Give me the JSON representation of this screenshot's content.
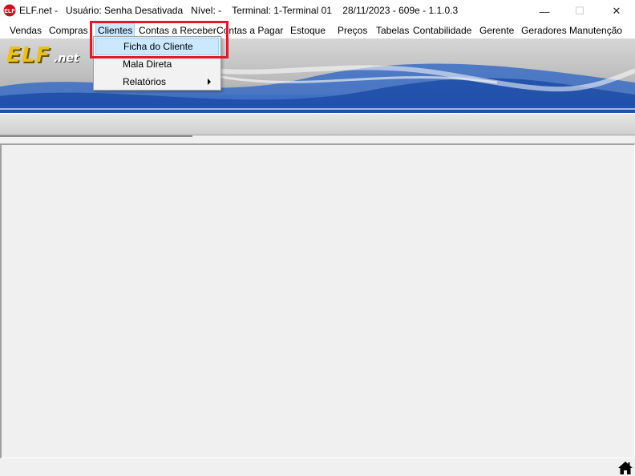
{
  "window": {
    "title": "ELF.net -   Usuário: Senha Desativada   Nível: -    Terminal: 1-Terminal 01    28/11/2023 - 609e - 1.1.0.3",
    "minimize_icon": "—",
    "maximize_icon": "☐",
    "close_icon": "✕"
  },
  "menubar": {
    "items": [
      {
        "label": "Vendas"
      },
      {
        "label": "Compras"
      },
      {
        "label": "Clientes"
      },
      {
        "label": "Contas a Receber"
      },
      {
        "label": "Contas a Pagar"
      },
      {
        "label": "Estoque"
      },
      {
        "label": "Preços"
      },
      {
        "label": "Tabelas"
      },
      {
        "label": "Contabilidade"
      },
      {
        "label": "Gerente"
      },
      {
        "label": "Geradores"
      },
      {
        "label": "Manutenção"
      }
    ]
  },
  "clientes_menu": {
    "items": [
      {
        "label": "Ficha do Cliente"
      },
      {
        "label": "Mala Direta"
      },
      {
        "label": "Relatórios"
      }
    ]
  },
  "banner": {
    "logo_main": "ELF",
    "logo_suffix": ".net"
  },
  "colors": {
    "highlight_border": "#e0192b",
    "menu_hover": "#cce8ff",
    "banner_blue": "#2f5fb8",
    "logo_gold": "#e8c21a"
  }
}
